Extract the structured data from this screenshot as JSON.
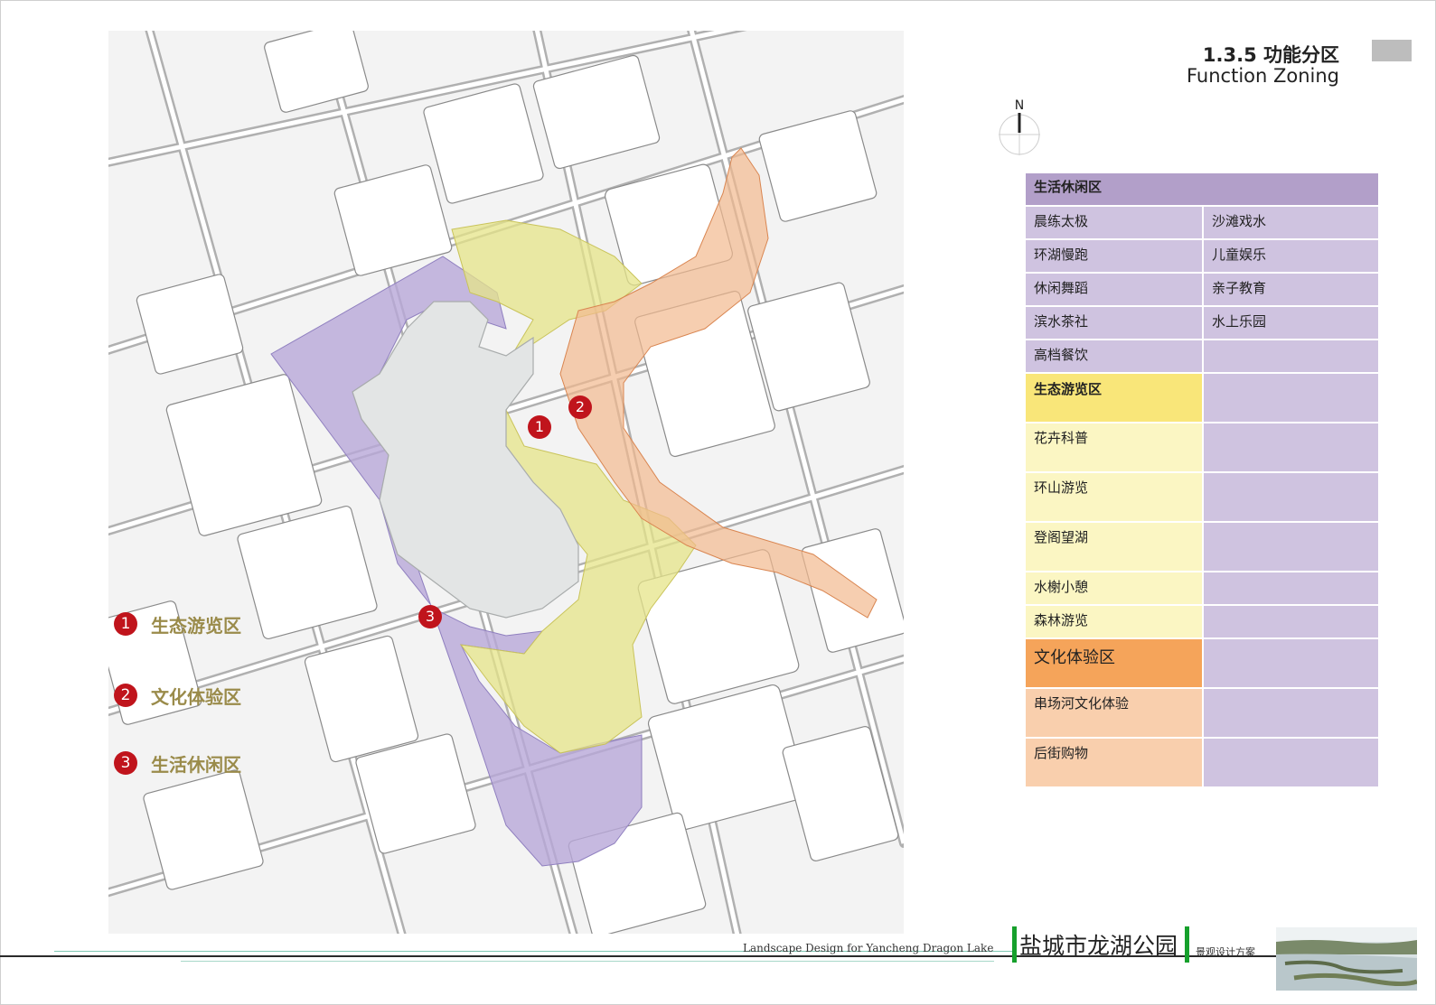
{
  "header": {
    "title_cn": "1.3.5 功能分区",
    "title_en": "Function Zoning"
  },
  "north": {
    "label": "N"
  },
  "zone_table": {
    "residential": {
      "header": "生活休闲区",
      "color": "#b29fc9",
      "cell_color": "#cfc3e0",
      "items_left": [
        "晨练太极",
        "环湖慢跑",
        "休闲舞蹈",
        "滨水茶社",
        "高档餐饮"
      ],
      "items_right": [
        "沙滩戏水",
        "儿童娱乐",
        "亲子教育",
        "水上乐园",
        ""
      ]
    },
    "ecological": {
      "header": "生态游览区",
      "color": "#f9e679",
      "cell_color": "#fbf6c3",
      "items": [
        "花卉科普",
        "环山游览",
        "登阁望湖",
        "水榭小憩",
        "森林游览"
      ]
    },
    "cultural": {
      "header": "文化体验区",
      "color": "#f5a45a",
      "cell_color": "#f9cfad",
      "items": [
        "串场河文化体验",
        "后街购物"
      ]
    }
  },
  "legend": [
    {
      "num": "1",
      "label": "生态游览区"
    },
    {
      "num": "2",
      "label": "文化体验区"
    },
    {
      "num": "3",
      "label": "生活休闲区"
    }
  ],
  "map_markers": [
    "1",
    "2",
    "3"
  ],
  "footer": {
    "en": "Landscape Design for Yancheng Dragon Lake",
    "cn": "盐城市龙湖公园",
    "sub": "景观设计方案"
  },
  "colors": {
    "zone_eco": "#e6e488",
    "zone_culture": "#f2b98f",
    "zone_residential": "#b8a8d8",
    "lake": "#e3e5e5",
    "marker": "#c0141c",
    "legend_text": "#9a8b4a",
    "footer_bar": "#16a02c"
  }
}
